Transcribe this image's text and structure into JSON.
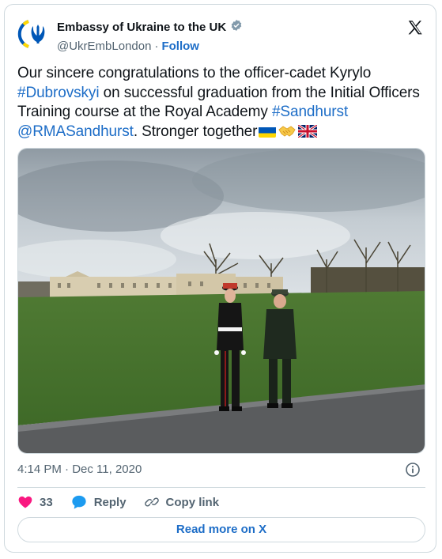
{
  "author": {
    "name": "Embassy of Ukraine to the UK",
    "handle": "@UkrEmbLondon",
    "separator": "·",
    "follow_label": "Follow",
    "verified": true
  },
  "tweet": {
    "text_1": "Our sincere congratulations to the officer-cadet Kyrylo ",
    "hashtag_1": "#Dubrovskyi",
    "text_2": " on successful graduation from the Initial Officers Training course at the Royal Academy ",
    "hashtag_2": "#Sandhurst",
    "mention": "@RMASandhurst",
    "text_3": ". Stronger together",
    "emojis": [
      "ukraine-flag",
      "handshake",
      "uk-flag"
    ]
  },
  "meta": {
    "timestamp": "4:14 PM · Dec 11, 2020"
  },
  "actions": {
    "like_count": "33",
    "reply_label": "Reply",
    "copy_label": "Copy link",
    "read_more_label": "Read more on X"
  },
  "colors": {
    "link": "#1d6dc7",
    "like": "#f91880",
    "reply": "#1d9bf0",
    "border": "#cfd9de",
    "secondary_text": "#536471"
  }
}
